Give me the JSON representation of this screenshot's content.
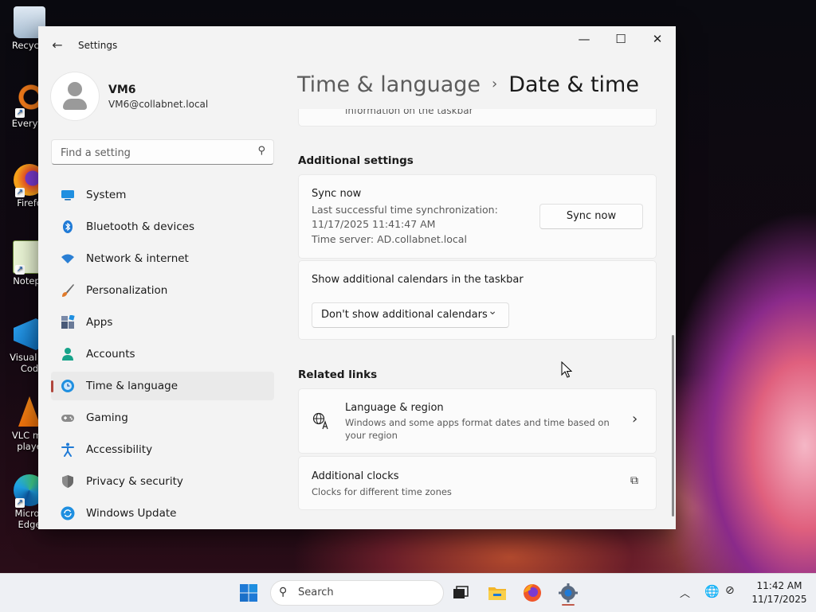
{
  "desktop": {
    "icons": [
      {
        "label": "Recycle",
        "name": "recycle-bin"
      },
      {
        "label": "Everyth",
        "name": "everything"
      },
      {
        "label": "Firefo",
        "name": "firefox"
      },
      {
        "label": "Notepa",
        "name": "notepad"
      },
      {
        "label": "Visual St Cod",
        "name": "visual-studio-code"
      },
      {
        "label": "VLC me playe",
        "name": "vlc"
      },
      {
        "label": "Micros Edge",
        "name": "edge"
      }
    ],
    "shortcut_glyph": "↗"
  },
  "window": {
    "app_title": "Settings",
    "back_glyph": "←",
    "minimize_glyph": "—",
    "maximize_glyph": "☐",
    "close_glyph": "✕"
  },
  "sidebar": {
    "user_name": "VM6",
    "user_email": "VM6@collabnet.local",
    "search_placeholder": "Find a setting",
    "search_glyph": "⚲",
    "items": [
      {
        "label": "System",
        "icon": "system-icon",
        "color": "#1f8fe0",
        "selected": false
      },
      {
        "label": "Bluetooth & devices",
        "icon": "bluetooth-icon",
        "color": "#1f7ad6",
        "selected": false
      },
      {
        "label": "Network & internet",
        "icon": "wifi-icon",
        "color": "#2a7fd4",
        "selected": false
      },
      {
        "label": "Personalization",
        "icon": "brush-icon",
        "color": "#e07a2a",
        "selected": false
      },
      {
        "label": "Apps",
        "icon": "apps-icon",
        "color": "#4a5a78",
        "selected": false
      },
      {
        "label": "Accounts",
        "icon": "accounts-icon",
        "color": "#17a38a",
        "selected": false
      },
      {
        "label": "Time & language",
        "icon": "globe-clock-icon",
        "color": "#1f8fe0",
        "selected": true
      },
      {
        "label": "Gaming",
        "icon": "gamepad-icon",
        "color": "#8a8a8a",
        "selected": false
      },
      {
        "label": "Accessibility",
        "icon": "accessibility-icon",
        "color": "#1f7ad6",
        "selected": false
      },
      {
        "label": "Privacy & security",
        "icon": "shield-icon",
        "color": "#7a7a7a",
        "selected": false
      },
      {
        "label": "Windows Update",
        "icon": "update-icon",
        "color": "#1f8fe0",
        "selected": false
      }
    ]
  },
  "main": {
    "breadcrumb_parent": "Time & language",
    "breadcrumb_sep": "›",
    "breadcrumb_current": "Date & time",
    "clipped_text": "information on the taskbar",
    "additional_settings_header": "Additional settings",
    "sync": {
      "title": "Sync now",
      "last_sync_line1": "Last successful time synchronization:",
      "last_sync_line2": "11/17/2025 11:41:47 AM",
      "time_server": "Time server: AD.collabnet.local",
      "button": "Sync now"
    },
    "calendars": {
      "title": "Show additional calendars in the taskbar",
      "selected": "Don't show additional calendars",
      "chevron": "⌄"
    },
    "related_links_header": "Related links",
    "language_region": {
      "title": "Language & region",
      "description": "Windows and some apps format dates and time based on your region",
      "chevron": "›"
    },
    "additional_clocks": {
      "title": "Additional clocks",
      "description": "Clocks for different time zones",
      "external": "⧉"
    }
  },
  "taskbar": {
    "search_label": "Search",
    "search_glyph": "⚲",
    "tray_chevron": "︿",
    "tray_globe": "🌐",
    "tray_net": "⊘",
    "time": "11:42 AM",
    "date": "11/17/2025"
  },
  "colors": {
    "accent": "#b0463c",
    "windows_blue": "#1f7ad6"
  }
}
